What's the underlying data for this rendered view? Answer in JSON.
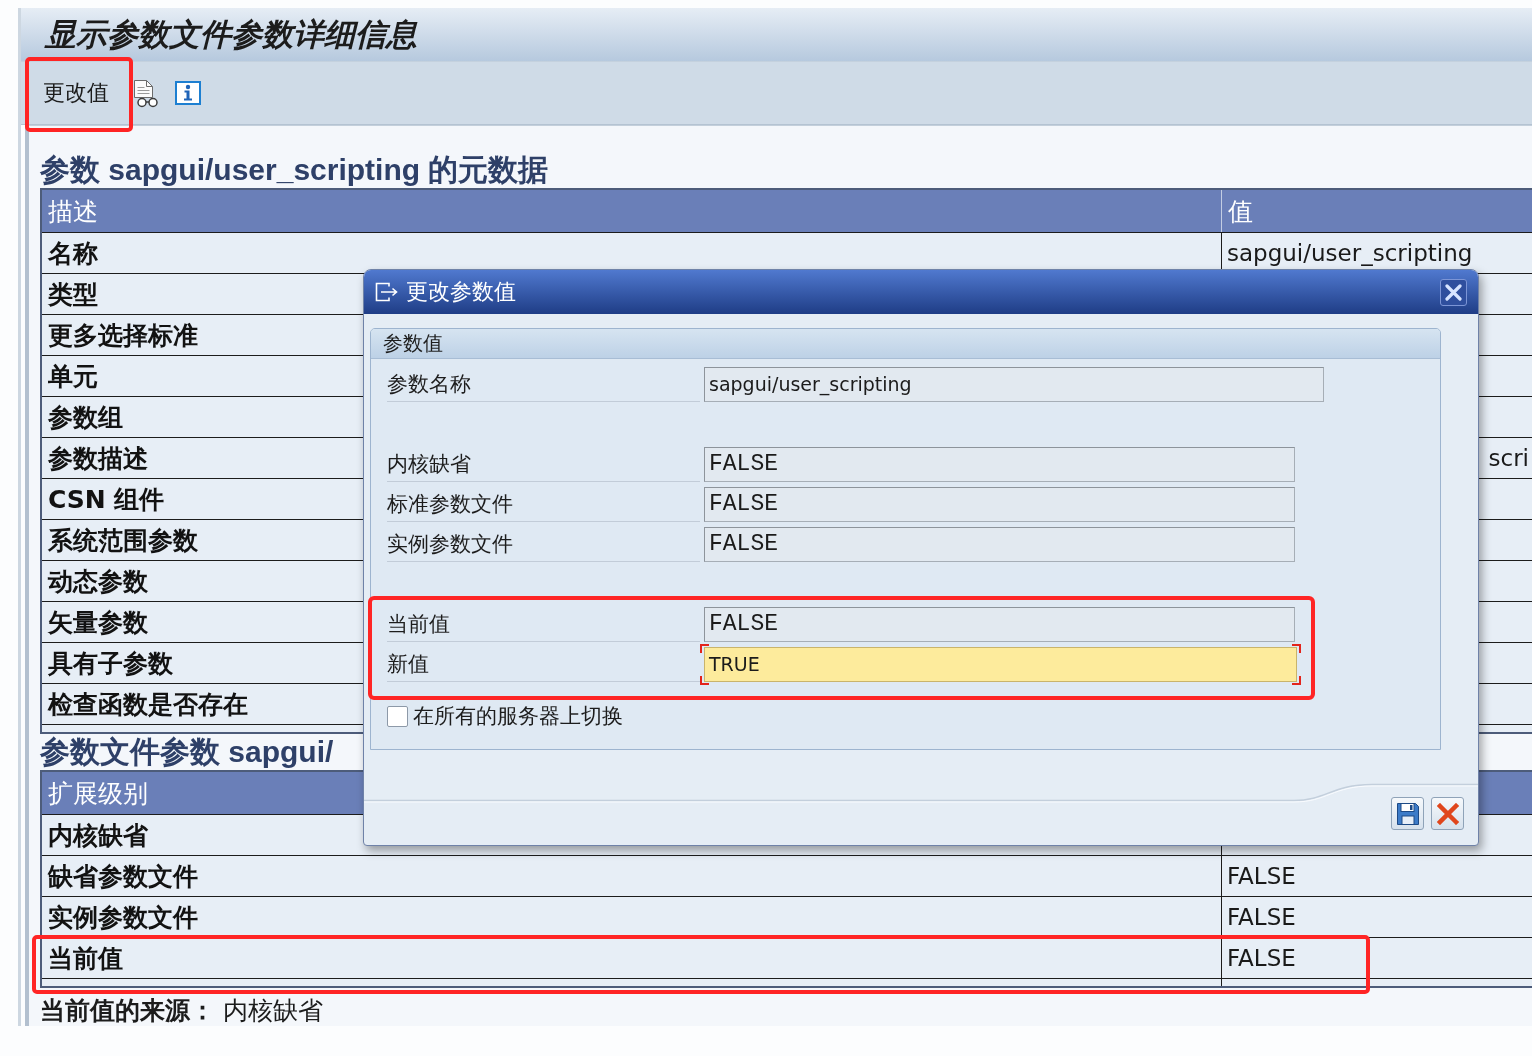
{
  "window": {
    "title": "显示参数文件参数详细信息"
  },
  "toolbar": {
    "button": {
      "label": "更改值",
      "highlighted": true
    }
  },
  "sections": [
    {
      "heading": "参数 sapgui/user_scripting 的元数据",
      "columns": [
        "描述",
        "值"
      ],
      "rows": [
        {
          "label": "名称",
          "value": "sapgui/user_scripting",
          "covered": false
        },
        {
          "label": "类型"
        },
        {
          "label": "更多选择标准"
        },
        {
          "label": "单元"
        },
        {
          "label": "参数组"
        },
        {
          "label": "参数描述",
          "value": "scri",
          "covered": true
        },
        {
          "label": "CSN 组件"
        },
        {
          "label": "系统范围参数"
        },
        {
          "label": "动态参数"
        },
        {
          "label": "矢量参数"
        },
        {
          "label": "具有子参数"
        },
        {
          "label": "检查函数是否存在"
        }
      ]
    },
    {
      "heading": "参数文件参数 sapgui/",
      "columns": [
        "扩展级别"
      ],
      "rows": [
        {
          "label": "内核缺省",
          "highlighted": false
        },
        {
          "label": "缺省参数文件",
          "value": "FALSE",
          "highlighted": false
        },
        {
          "label": "实例参数文件",
          "value": "FALSE",
          "highlighted": false
        },
        {
          "label": "当前值",
          "value": "FALSE",
          "highlighted": true
        }
      ]
    }
  ],
  "source": "**当前值的来源：** 内核缺省",
  "dialog": {
    "title": "更改参数值",
    "group_title": "参数值",
    "field_groups": [
      {
        "highlighted": false,
        "fields": [
          {
            "label": "参数名称",
            "value": "sapgui/user_scripting",
            "kind": "text",
            "focused": false
          }
        ]
      },
      {
        "highlighted": false,
        "fields": [
          {
            "label": "内核缺省",
            "value": "FALSE",
            "kind": "flag",
            "focused": false
          },
          {
            "label": "标准参数文件",
            "value": "FALSE",
            "kind": "flag",
            "focused": false
          },
          {
            "label": "实例参数文件",
            "value": "FALSE",
            "kind": "flag",
            "focused": false
          }
        ]
      },
      {
        "highlighted": true,
        "fields": [
          {
            "label": "当前值",
            "value": "FALSE",
            "kind": "flag",
            "focused": false
          },
          {
            "label": "新值",
            "value": "TRUE",
            "kind": "input",
            "focused": true
          }
        ]
      }
    ],
    "checkbox": {
      "label": "在所有的服务器上切换",
      "checked": false
    }
  }
}
